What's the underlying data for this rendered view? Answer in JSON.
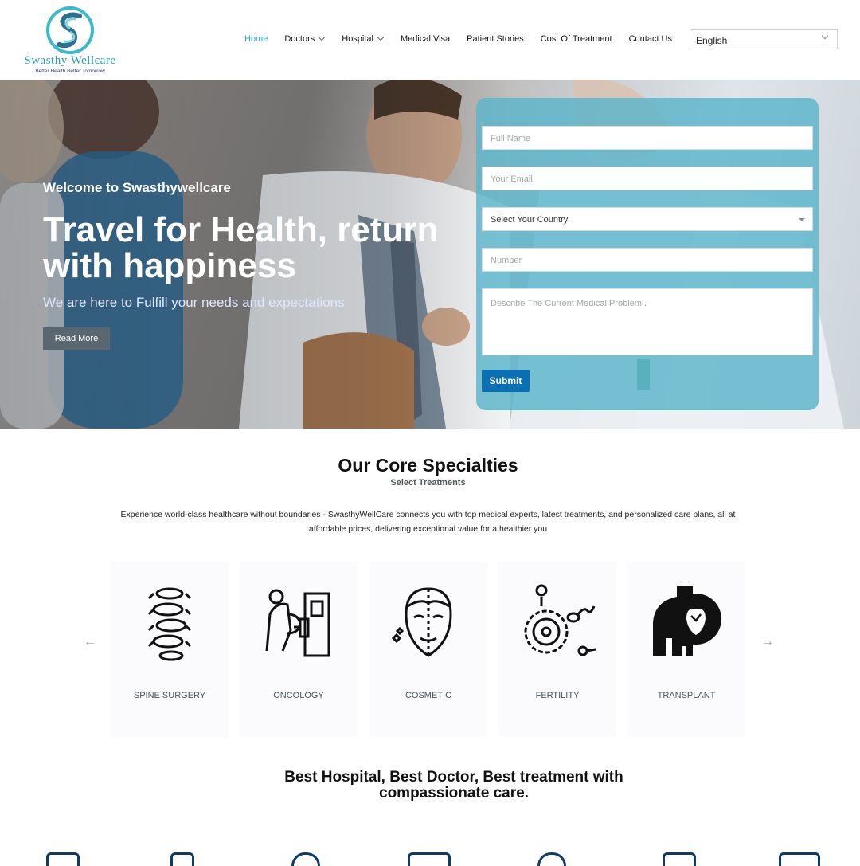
{
  "brand": {
    "name": "Swasthy Wellcare",
    "tagline": "Better Health Better Tomorrow",
    "colors": {
      "teal": "#2aa3c8",
      "navy": "#0f3b6b",
      "submit": "#0a6fb3"
    }
  },
  "nav": {
    "items": [
      {
        "label": "Home",
        "active": true,
        "dropdown": false
      },
      {
        "label": "Doctors",
        "active": false,
        "dropdown": true
      },
      {
        "label": "Hospital",
        "active": false,
        "dropdown": true
      },
      {
        "label": "Medical Visa",
        "active": false,
        "dropdown": false
      },
      {
        "label": "Patient Stories",
        "active": false,
        "dropdown": false
      },
      {
        "label": "Cost Of Treatment",
        "active": false,
        "dropdown": false
      },
      {
        "label": "Contact Us",
        "active": false,
        "dropdown": false
      }
    ],
    "language": "English"
  },
  "hero": {
    "welcome": "Welcome to Swasthywellcare",
    "title": "Travel for Health, return with happiness",
    "subtitle": "We are here to Fulfill your needs and expectations",
    "cta": "Read More"
  },
  "form": {
    "full_name_placeholder": "Full Name",
    "email_placeholder": "Your Email",
    "country_value": "Select Your Country",
    "number_placeholder": "Number",
    "problem_placeholder": "Describe The Current Medical Problem..",
    "submit": "Submit"
  },
  "specialties": {
    "title": "Our Core Specialties",
    "subtitle": "Select Treatments",
    "description": "Experience world-class healthcare without boundaries - SwasthyWellCare connects you with top medical experts, latest treatments, and personalized care plans, all at affordable prices, delivering exceptional value for a healthier you",
    "prev_arrow": "←",
    "next_arrow": "→",
    "cards": [
      {
        "label": "SPINE SURGERY",
        "icon": "spine-icon"
      },
      {
        "label": "ONCOLOGY",
        "icon": "mammography-icon"
      },
      {
        "label": "COSMETIC",
        "icon": "face-icon"
      },
      {
        "label": "FERTILITY",
        "icon": "fertility-icon"
      },
      {
        "label": "TRANSPLANT",
        "icon": "heart-transplant-icon"
      }
    ]
  },
  "best": {
    "title": "Best Hospital, Best Doctor, Best treatment with compassionate care."
  }
}
